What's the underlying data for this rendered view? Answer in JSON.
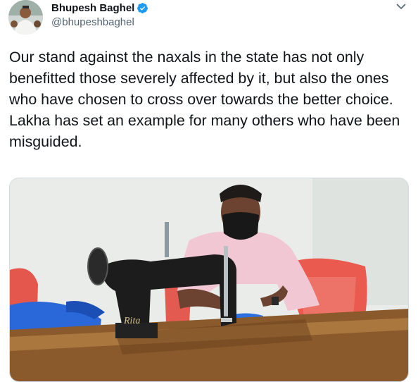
{
  "author": {
    "display_name": "Bhupesh Baghel",
    "handle": "@bhupeshbaghel",
    "verified": true,
    "avatar_icon": "profile-photo"
  },
  "menu": {
    "icon": "chevron-down-icon"
  },
  "tweet": {
    "paragraphs": [
      "Our stand against the naxals in the state has not only benefitted those severely affected by it, but also the ones who have chosen to cross over towards the better choice.",
      "Lakha has set an example for many others who have been misguided."
    ]
  },
  "media": {
    "type": "photo",
    "machine_brand": "Rita"
  },
  "colors": {
    "verified_badge": "#1d9bf0",
    "handle": "#536471",
    "text": "#0f1419"
  }
}
